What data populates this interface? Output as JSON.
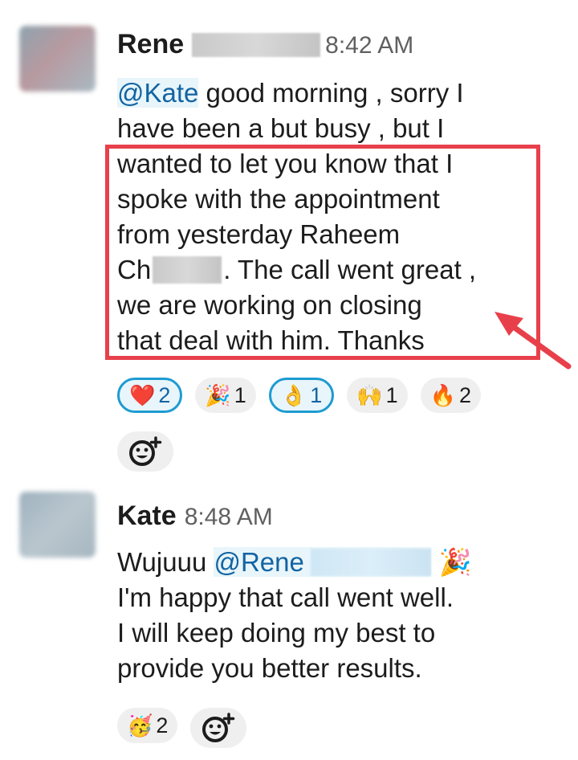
{
  "messages": [
    {
      "author": "Rene",
      "time": "8:42 AM",
      "mention": "@Kate",
      "lines": [
        " good morning , sorry I",
        "have been a but busy , but I",
        "wanted to let you know that I",
        "spoke with the appointment",
        "from yesterday Raheem",
        "Ch",
        ". The call went great ,",
        "we are working on closing",
        "that deal with him. Thanks"
      ],
      "reactions": [
        {
          "emoji": "❤️",
          "icon": "heart-icon",
          "count": "2",
          "active": true
        },
        {
          "emoji": "🎉",
          "icon": "party-popper-icon",
          "count": "1",
          "active": false
        },
        {
          "emoji": "👌",
          "icon": "ok-hand-icon",
          "count": "1",
          "active": true
        },
        {
          "emoji": "🙌",
          "icon": "raised-hands-icon",
          "count": "1",
          "active": false
        },
        {
          "emoji": "🔥",
          "icon": "fire-icon",
          "count": "2",
          "active": false
        }
      ]
    },
    {
      "author": "Kate",
      "time": "8:48 AM",
      "line1_prefix": "Wujuuu ",
      "mention": "@Rene",
      "line1_emoji": "🎉",
      "lines": [
        "I'm happy that call went well.",
        "I will keep doing my best to",
        "provide you better results."
      ],
      "reactions": [
        {
          "emoji": "🥳",
          "icon": "partying-face-icon",
          "count": "2",
          "active": false
        }
      ]
    }
  ],
  "colors": {
    "highlight": "#e8404b",
    "mention": "#1264a3",
    "active_reaction_border": "#1d9bd1"
  }
}
